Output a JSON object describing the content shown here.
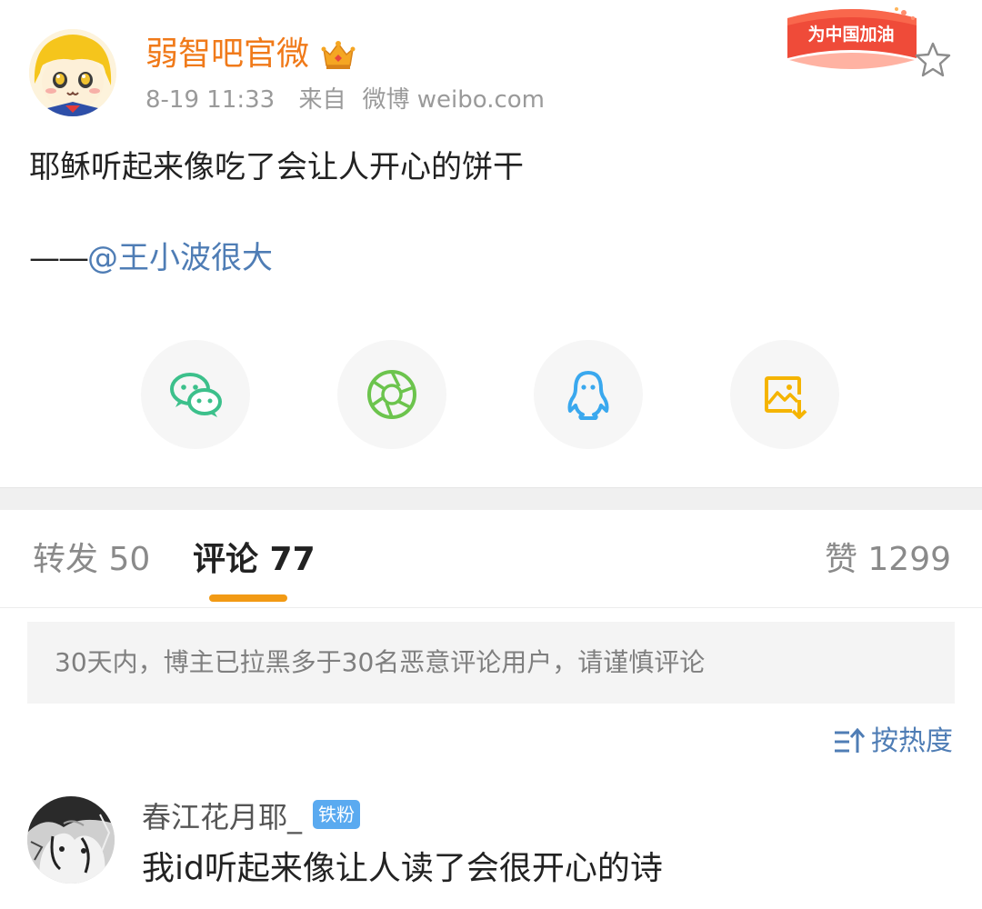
{
  "post": {
    "author": "弱智吧官微",
    "vip_icon": "crown-icon",
    "time": "8-19 11:33",
    "source_prefix": "来自",
    "source": "微博 weibo.com",
    "banner_text": "为中国加油",
    "text": "耶稣听起来像吃了会让人开心的饼干",
    "credit_dash": "——",
    "credit_mention": "@王小波很大"
  },
  "share": [
    {
      "name": "wechat-share-button",
      "icon": "wechat-icon"
    },
    {
      "name": "moments-share-button",
      "icon": "camera-shutter-icon"
    },
    {
      "name": "qq-share-button",
      "icon": "qq-penguin-icon"
    },
    {
      "name": "save-image-button",
      "icon": "image-download-icon"
    }
  ],
  "tabs": {
    "repost": "转发 50",
    "comments": "评论 77",
    "likes": "赞 1299"
  },
  "notice": "30天内，博主已拉黑多于30名恶意评论用户，请谨慎评论",
  "sort_label": "按热度",
  "comment": {
    "user": "春江花月耶_",
    "badge": "铁粉",
    "text": "我id听起来像让人读了会很开心的诗"
  },
  "colors": {
    "author": "#f07a1a",
    "mention": "#4f7db5",
    "accent": "#f29a14",
    "wechat": "#3cc08b",
    "moments": "#6cc44d",
    "qq": "#3aa8ee",
    "save": "#f5b400",
    "badge": "#5aaaf0"
  }
}
